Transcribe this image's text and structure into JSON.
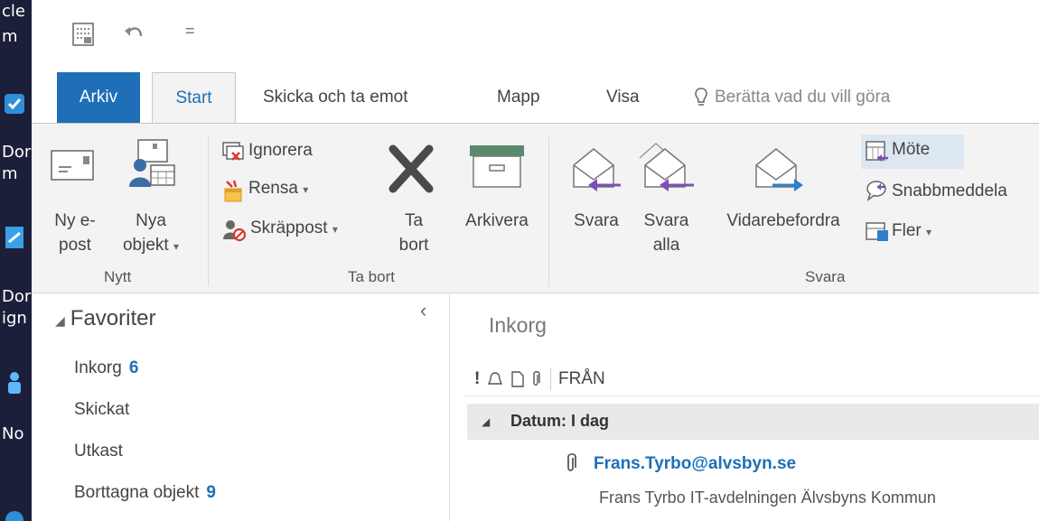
{
  "desktop": {
    "labels": [
      "cle",
      "m",
      "Dor",
      "m",
      "Dor",
      "ign",
      "No"
    ]
  },
  "quick_access": {
    "dropdown_glyph": "="
  },
  "tabs": {
    "arkiv": "Arkiv",
    "start": "Start",
    "send_receive": "Skicka och ta emot",
    "folder": "Mapp",
    "view": "Visa",
    "tell_me": "Berätta vad du vill göra"
  },
  "ribbon": {
    "new_group": {
      "new_email_l1": "Ny e-",
      "new_email_l2": "post",
      "new_items_l1": "Nya",
      "new_items_l2": "objekt",
      "label": "Nytt"
    },
    "delete_group": {
      "ignore": "Ignorera",
      "clean_up": "Rensa",
      "junk": "Skräppost",
      "delete_l1": "Ta",
      "delete_l2": "bort",
      "archive": "Arkivera",
      "label": "Ta bort"
    },
    "respond_group": {
      "reply": "Svara",
      "reply_all_l1": "Svara",
      "reply_all_l2": "alla",
      "forward": "Vidarebefordra",
      "meeting": "Möte",
      "im": "Snabbmeddela",
      "more": "Fler",
      "label": "Svara"
    },
    "dropdown_arrow": "▾"
  },
  "folder_pane": {
    "favorites": "Favoriter",
    "collapse": "‹",
    "items": [
      {
        "label": "Inkorg",
        "count": "6"
      },
      {
        "label": "Skickat",
        "count": ""
      },
      {
        "label": "Utkast",
        "count": ""
      },
      {
        "label": "Borttagna objekt",
        "count": "9"
      }
    ]
  },
  "mail_list": {
    "title": "Inkorg",
    "column_from": "FRÅN",
    "group_header": "Datum: I dag",
    "items": [
      {
        "sender": "Frans.Tyrbo@alvsbyn.se",
        "preview": "Frans Tyrbo  IT-avdelningen  Älvsbyns Kommun"
      }
    ]
  },
  "colors": {
    "accent": "#1e6fb8",
    "ribbon_bg": "#f3f3f3",
    "desktop": "#1b1f3a",
    "arrow_purple": "#7b4fb3",
    "arrow_blue": "#2f7fc9"
  }
}
